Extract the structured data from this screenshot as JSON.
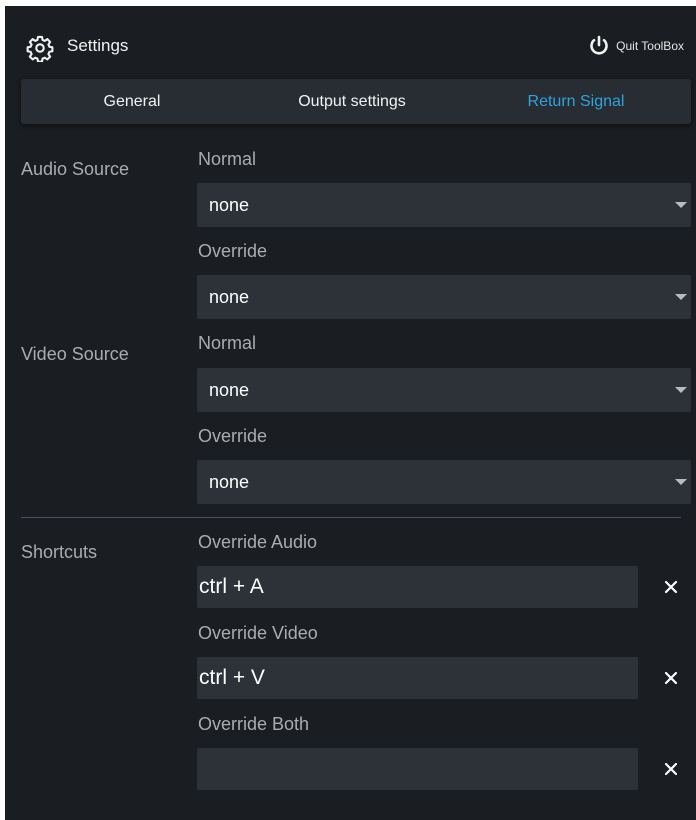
{
  "header": {
    "title": "Settings",
    "settings_icon": "gear-icon",
    "quit_label": "Quit ToolBox",
    "quit_icon": "power-icon"
  },
  "tabs": [
    {
      "label": "General",
      "active": false
    },
    {
      "label": "Output settings",
      "active": false
    },
    {
      "label": "Return Signal",
      "active": true
    }
  ],
  "audio_source": {
    "label": "Audio Source",
    "normal_label": "Normal",
    "normal_value": "none",
    "override_label": "Override",
    "override_value": "none"
  },
  "video_source": {
    "label": "Video Source",
    "normal_label": "Normal",
    "normal_value": "none",
    "override_label": "Override",
    "override_value": "none"
  },
  "shortcuts": {
    "label": "Shortcuts",
    "items": [
      {
        "label": "Override Audio",
        "value": "ctrl + A"
      },
      {
        "label": "Override Video",
        "value": "ctrl + V"
      },
      {
        "label": "Override Both",
        "value": ""
      }
    ],
    "clear_icon": "close-icon"
  },
  "colors": {
    "panel_bg": "#1a1d21",
    "tabbar_bg": "#272d33",
    "field_bg": "#2c3238",
    "accent": "#2ea3dc",
    "muted_text": "#a9adb2"
  }
}
